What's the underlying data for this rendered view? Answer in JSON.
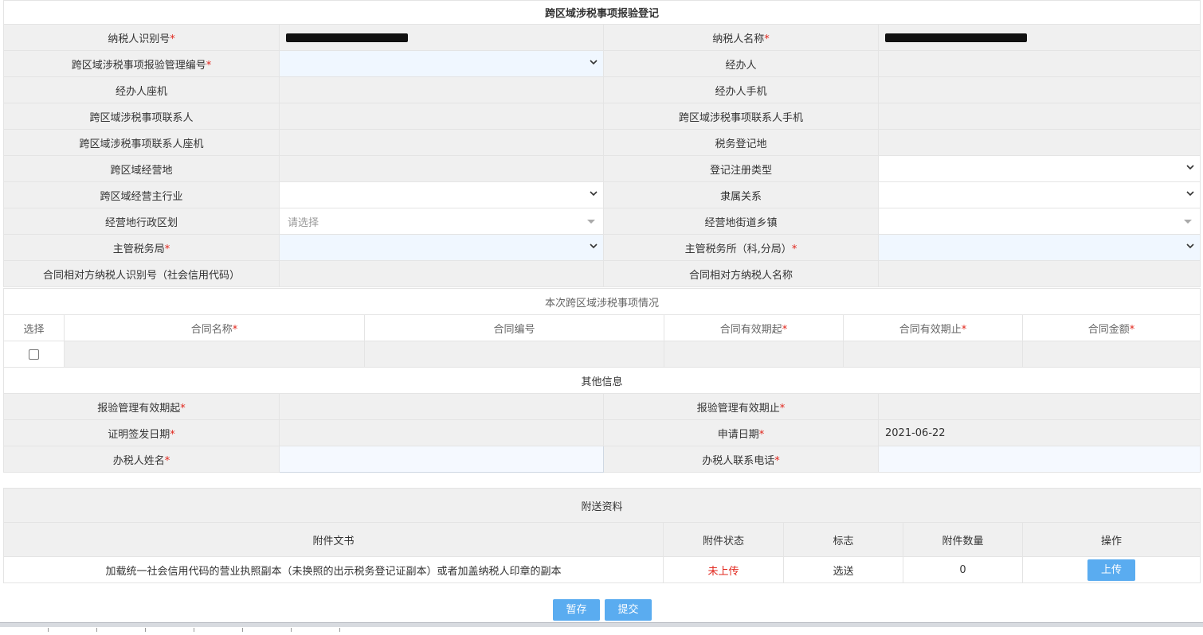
{
  "form": {
    "title": "跨区域涉税事项报验登记",
    "required_mark": "*",
    "rows": [
      {
        "l1": "纳税人识别号",
        "r1": true,
        "l2": "纳税人名称",
        "r2": true
      },
      {
        "l1": "跨区域涉税事项报验管理编号",
        "r1": true,
        "l2": "经办人"
      },
      {
        "l1": "经办人座机",
        "l2": "经办人手机"
      },
      {
        "l1": "跨区域涉税事项联系人",
        "l2": "跨区域涉税事项联系人手机"
      },
      {
        "l1": "跨区域涉税事项联系人座机",
        "l2": "税务登记地"
      },
      {
        "l1": "跨区域经营地",
        "l2": "登记注册类型"
      },
      {
        "l1": "跨区域经营主行业",
        "l2": "隶属关系"
      },
      {
        "l1": "经营地行政区划",
        "v1": "请选择",
        "l2": "经营地街道乡镇"
      },
      {
        "l1": "主管税务局",
        "r1": true,
        "l2": "主管税务所（科,分局）",
        "r2": true
      },
      {
        "l1": "合同相对方纳税人识别号（社会信用代码）",
        "l2": "合同相对方纳税人名称"
      }
    ]
  },
  "contracts": {
    "section_title": "本次跨区域涉税事项情况",
    "headers": [
      "选择",
      "合同名称",
      "合同编号",
      "合同有效期起",
      "合同有效期止",
      "合同金额"
    ]
  },
  "other": {
    "section_title": "其他信息",
    "rows": [
      {
        "l1": "报验管理有效期起",
        "l2": "报验管理有效期止"
      },
      {
        "l1": "证明签发日期",
        "l2": "申请日期",
        "v2": "2021-06-22"
      },
      {
        "l1": "办税人姓名",
        "l2": "办税人联系电话"
      }
    ]
  },
  "attachments": {
    "section_title": "附送资料",
    "headers": [
      "附件文书",
      "附件状态",
      "标志",
      "附件数量",
      "操作"
    ],
    "rows": [
      {
        "doc": "加载统一社会信用代码的营业执照副本（未换照的出示税务登记证副本）或者加盖纳税人印章的副本",
        "status": "未上传",
        "flag": "选送",
        "count": "0",
        "action": "上传"
      }
    ]
  },
  "buttons": {
    "save": "暂存",
    "submit": "提交"
  },
  "colors": {
    "accent": "#5aacf0",
    "required": "#e1251b",
    "label_bg": "#f0f0f0"
  }
}
